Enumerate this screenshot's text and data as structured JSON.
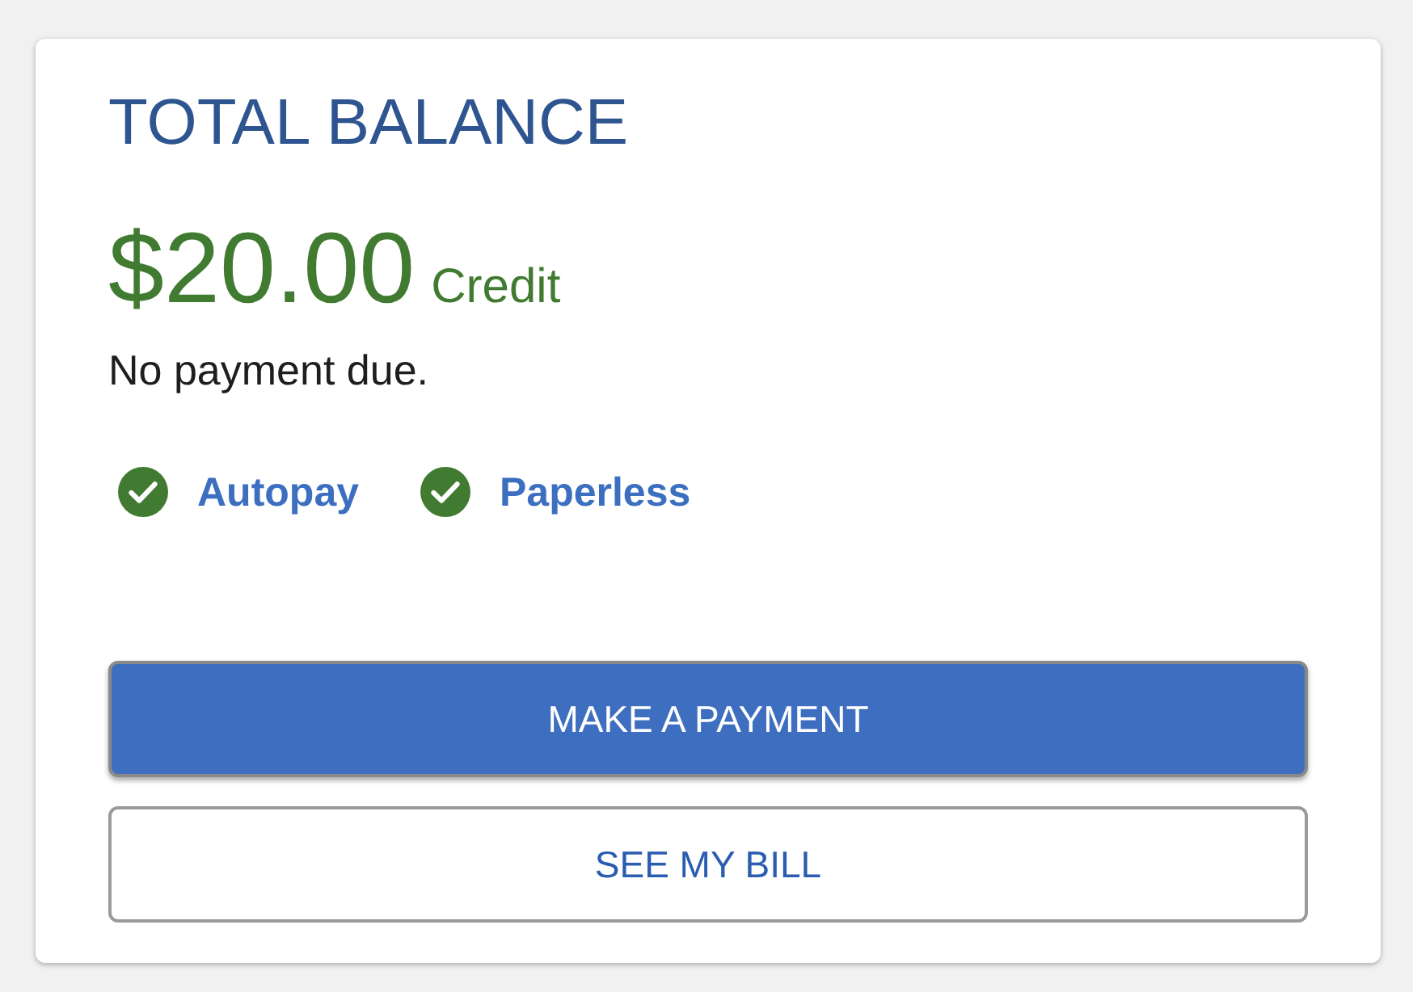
{
  "card": {
    "title": "TOTAL BALANCE",
    "amount": "$20.00",
    "amount_label": "Credit",
    "message": "No payment due.",
    "features": [
      {
        "label": "Autopay",
        "checked": true
      },
      {
        "label": "Paperless",
        "checked": true
      }
    ],
    "buttons": [
      {
        "label": "MAKE A PAYMENT",
        "kind": "primary"
      },
      {
        "label": "SEE MY BILL",
        "kind": "secondary"
      }
    ]
  }
}
